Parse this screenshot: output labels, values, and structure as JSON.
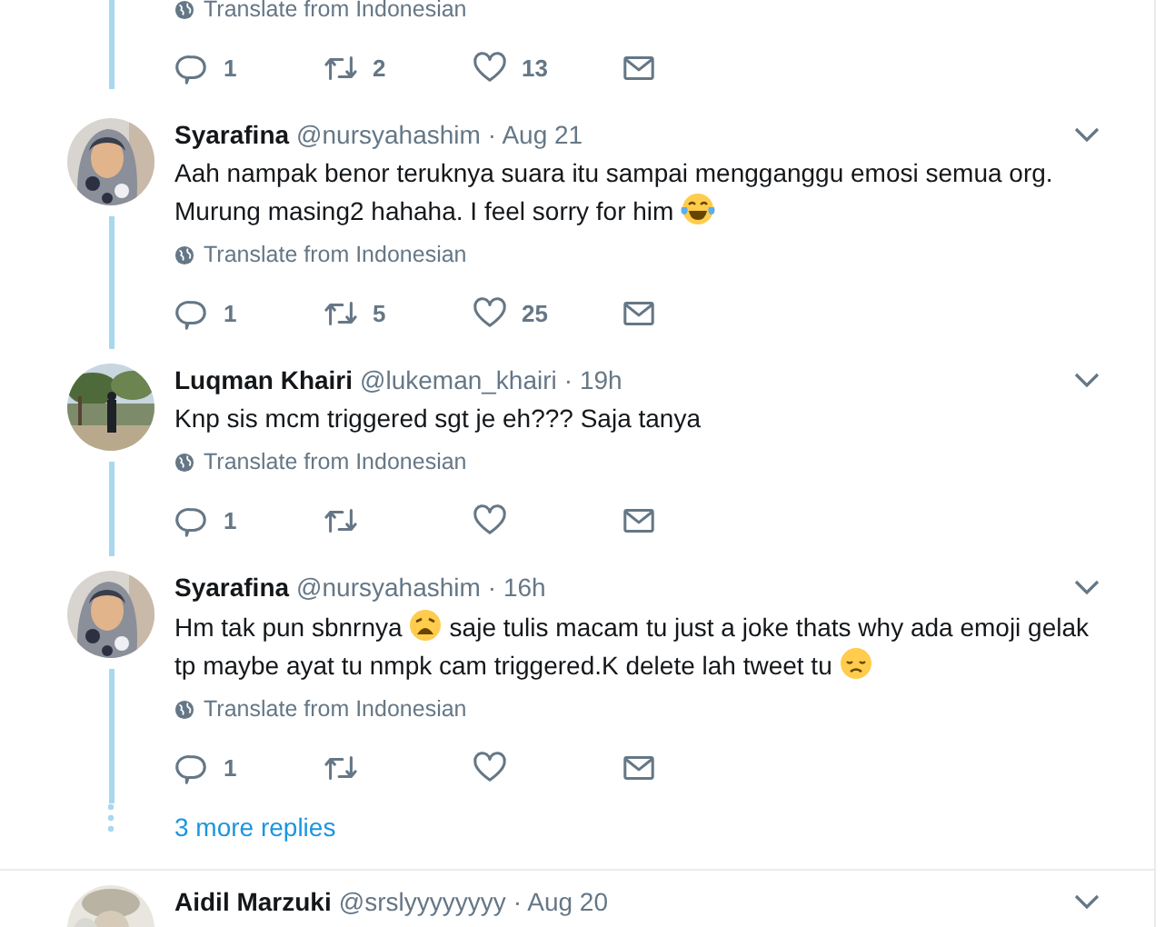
{
  "continued_tweet": {
    "translate": "Translate from Indonesian",
    "actions": [
      {
        "kind": "reply",
        "count": "1"
      },
      {
        "kind": "retweet",
        "count": "2"
      },
      {
        "kind": "like",
        "count": "13"
      },
      {
        "kind": "message"
      }
    ]
  },
  "replies": [
    {
      "name": "Syarafina",
      "handle": "@nursyahashim",
      "time": "· Aug 21",
      "body": [
        {
          "kind": "text",
          "text": "Aah nampak benor teruknya suara itu sampai mengganggu emosi semua org. Murung masing2 hahaha. I feel sorry for him"
        },
        {
          "kind": "laughing"
        }
      ],
      "translate": "Translate from Indonesian",
      "actions": [
        {
          "kind": "reply",
          "count": "1"
        },
        {
          "kind": "retweet",
          "count": "5"
        },
        {
          "kind": "like",
          "count": "25"
        },
        {
          "kind": "message"
        }
      ]
    },
    {
      "name": "Luqman Khairi",
      "handle": "@lukeman_khairi",
      "time": "· 19h",
      "body": [
        {
          "kind": "text",
          "text": "Knp sis mcm triggered sgt je eh??? Saja tanya"
        }
      ],
      "translate": "Translate from Indonesian",
      "actions": [
        {
          "kind": "reply",
          "count": "1"
        },
        {
          "kind": "retweet"
        },
        {
          "kind": "like"
        },
        {
          "kind": "message"
        }
      ]
    },
    {
      "name": "Syarafina",
      "handle": "@nursyahashim",
      "time": "· 16h",
      "body": [
        {
          "kind": "text",
          "text": "Hm tak pun sbnrnya"
        },
        {
          "kind": "weary"
        },
        {
          "kind": "text",
          "text": "saje tulis macam tu just a joke thats why ada emoji gelak tp maybe ayat tu nmpk cam triggered.K delete lah tweet tu"
        },
        {
          "kind": "sad"
        }
      ],
      "translate": "Translate from Indonesian",
      "actions": [
        {
          "kind": "reply",
          "count": "1"
        },
        {
          "kind": "retweet"
        },
        {
          "kind": "like"
        },
        {
          "kind": "message"
        }
      ]
    }
  ],
  "more_replies": "3 more replies",
  "next_tweet": {
    "name": "Aidil Marzuki",
    "handle": "@srslyyyyyyyy",
    "time": "· Aug 20"
  }
}
